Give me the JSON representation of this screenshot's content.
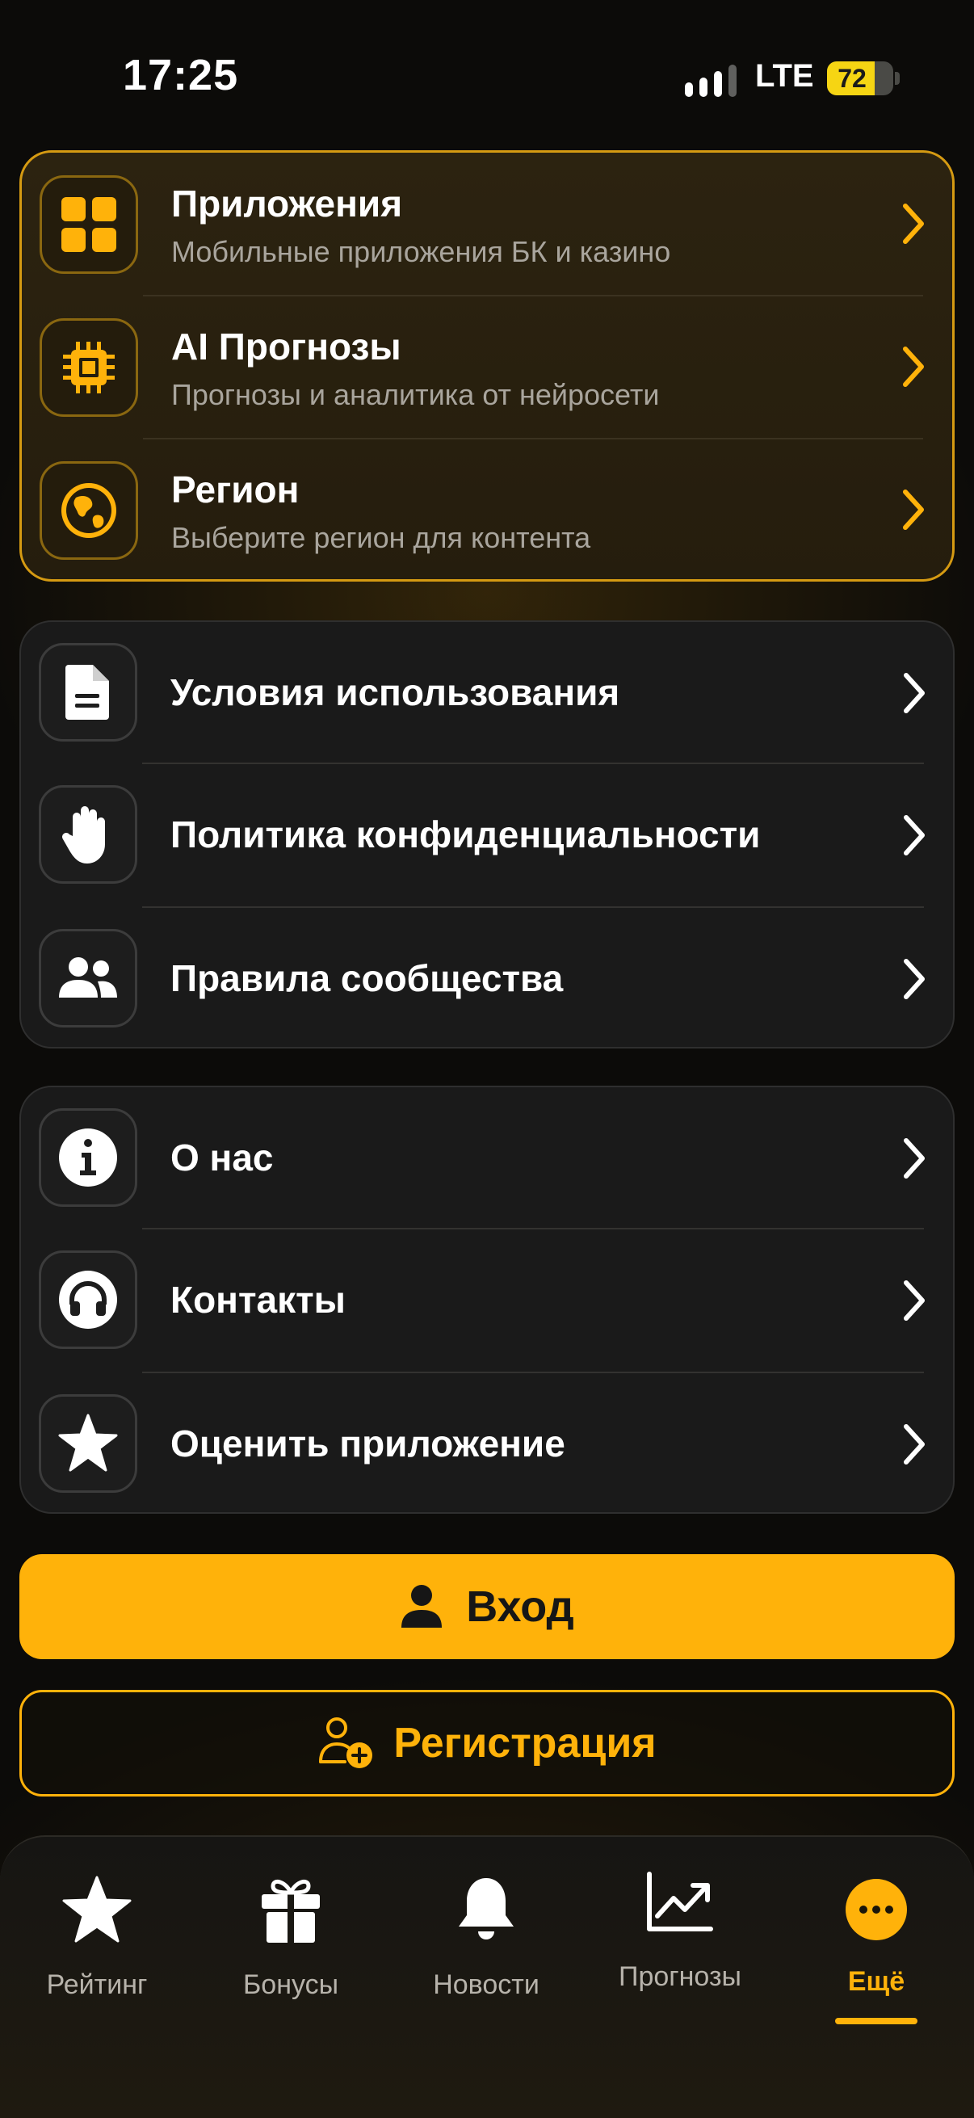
{
  "status_bar": {
    "time": "17:25",
    "network": "LTE",
    "battery": "72",
    "battery_level": 0.72
  },
  "group1": [
    {
      "icon": "grid-icon",
      "title": "Приложения",
      "subtitle": "Мобильные приложения БК и казино"
    },
    {
      "icon": "chip-icon",
      "title": "AI Прогнозы",
      "subtitle": "Прогнозы и аналитика от нейросети"
    },
    {
      "icon": "globe-icon",
      "title": "Регион",
      "subtitle": "Выберите регион для контента"
    }
  ],
  "group2": [
    {
      "icon": "document-icon",
      "title": "Условия использования"
    },
    {
      "icon": "hand-icon",
      "title": "Политика конфиденциальности"
    },
    {
      "icon": "people-icon",
      "title": "Правила сообщества"
    }
  ],
  "group3": [
    {
      "icon": "info-icon",
      "title": "О нас"
    },
    {
      "icon": "headphones-icon",
      "title": "Контакты"
    },
    {
      "icon": "star-icon",
      "title": "Оценить приложение"
    }
  ],
  "buttons": {
    "login": "Вход",
    "register": "Регистрация"
  },
  "tabs": [
    {
      "icon": "star-icon",
      "label": "Рейтинг"
    },
    {
      "icon": "gift-icon",
      "label": "Бонусы"
    },
    {
      "icon": "bell-icon",
      "label": "Новости"
    },
    {
      "icon": "chart-icon",
      "label": "Прогнозы"
    },
    {
      "icon": "more-icon",
      "label": "Ещё",
      "active": true
    }
  ],
  "colors": {
    "accent": "#ffb20a",
    "card": "#1a1a1a",
    "background": "#0c0b09"
  }
}
